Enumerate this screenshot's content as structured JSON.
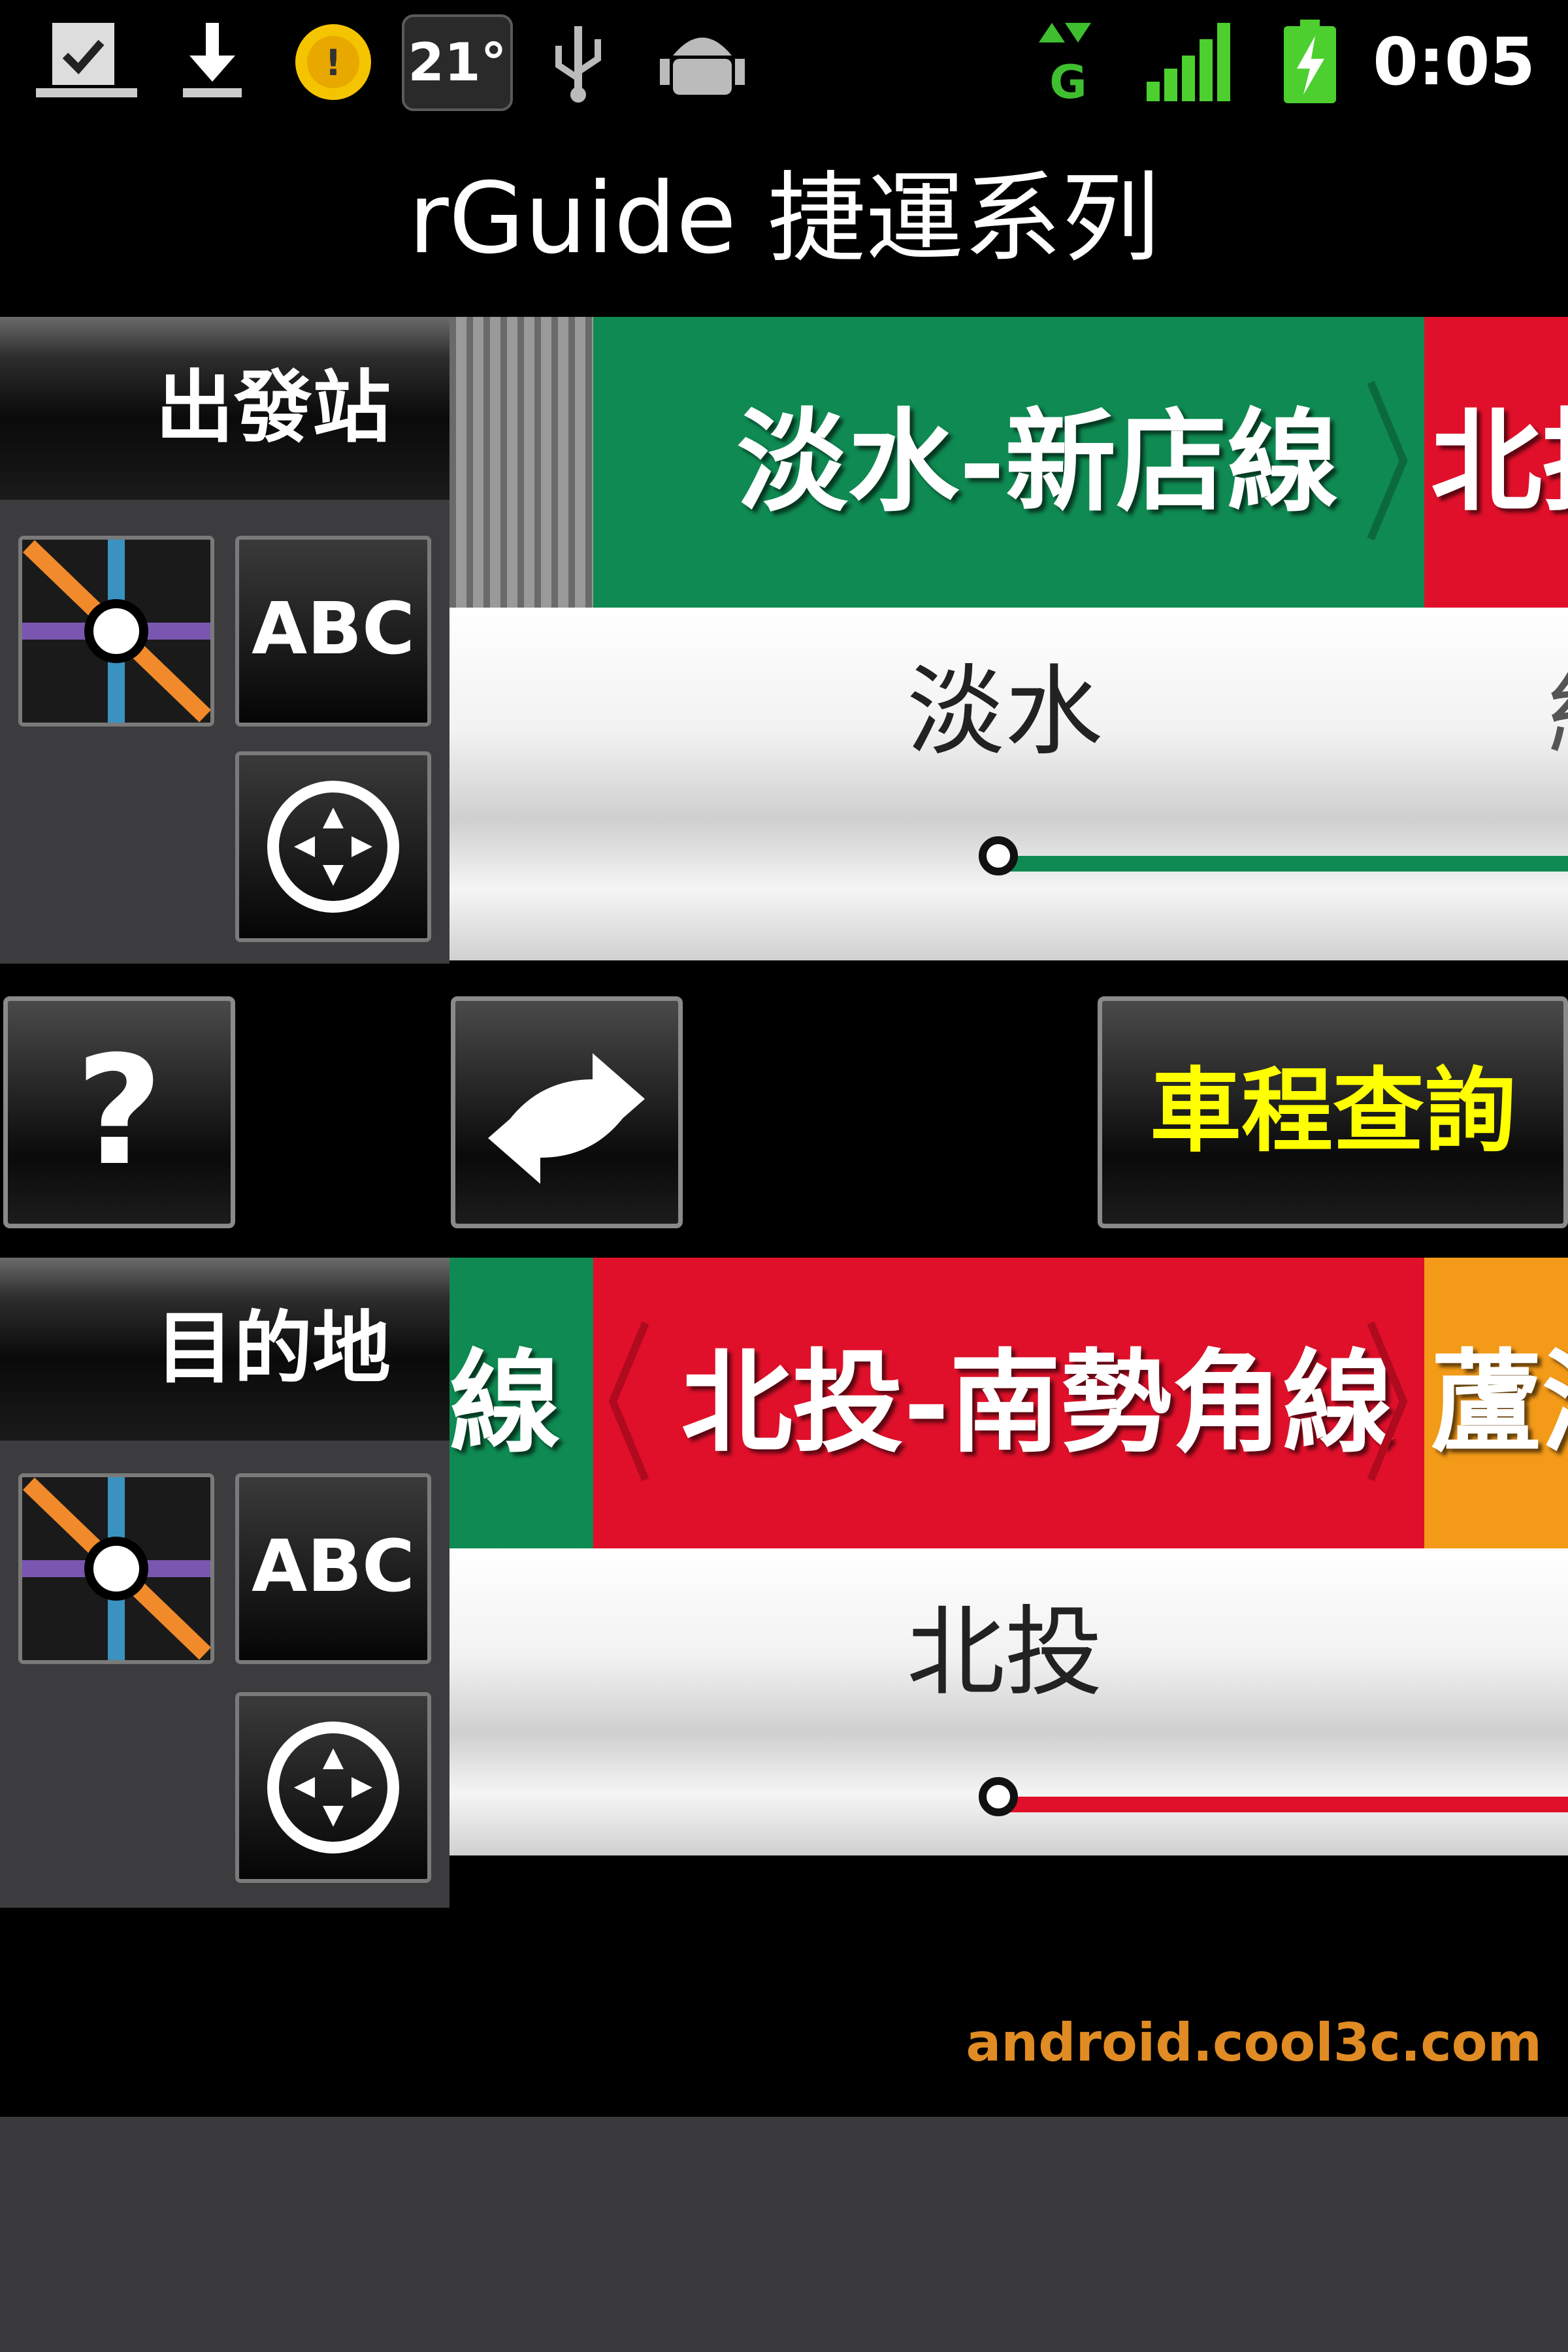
{
  "status_bar": {
    "temperature": "21°",
    "time": "0:05",
    "network_badge": "G",
    "icons": [
      "task-check-icon",
      "download-icon",
      "weather-sun-icon",
      "usb-icon",
      "android-debug-icon",
      "data-transfer-icon",
      "signal-icon",
      "battery-charging-icon"
    ]
  },
  "app_title": "rGuide 捷運系列",
  "origin": {
    "label": "出發站",
    "abc_label": "ABC",
    "prev_line": "",
    "current_line": "淡水-新店線",
    "next_line": "北投",
    "station": "淡水",
    "next_station_partial": "紅",
    "line_color": "#0f8a52"
  },
  "destination": {
    "label": "目的地",
    "abc_label": "ABC",
    "prev_line": "線",
    "current_line": "北投-南勢角線",
    "next_line": "蘆洲",
    "station": "北投",
    "line_color": "#e0102a"
  },
  "controls": {
    "help_label": "?",
    "query_label": "車程查詢"
  },
  "watermark": "android.cool3c.com",
  "colors": {
    "green_line": "#0f8a52",
    "red_line": "#e0102a",
    "orange_line": "#f39a18",
    "query_text": "#ffff00"
  }
}
